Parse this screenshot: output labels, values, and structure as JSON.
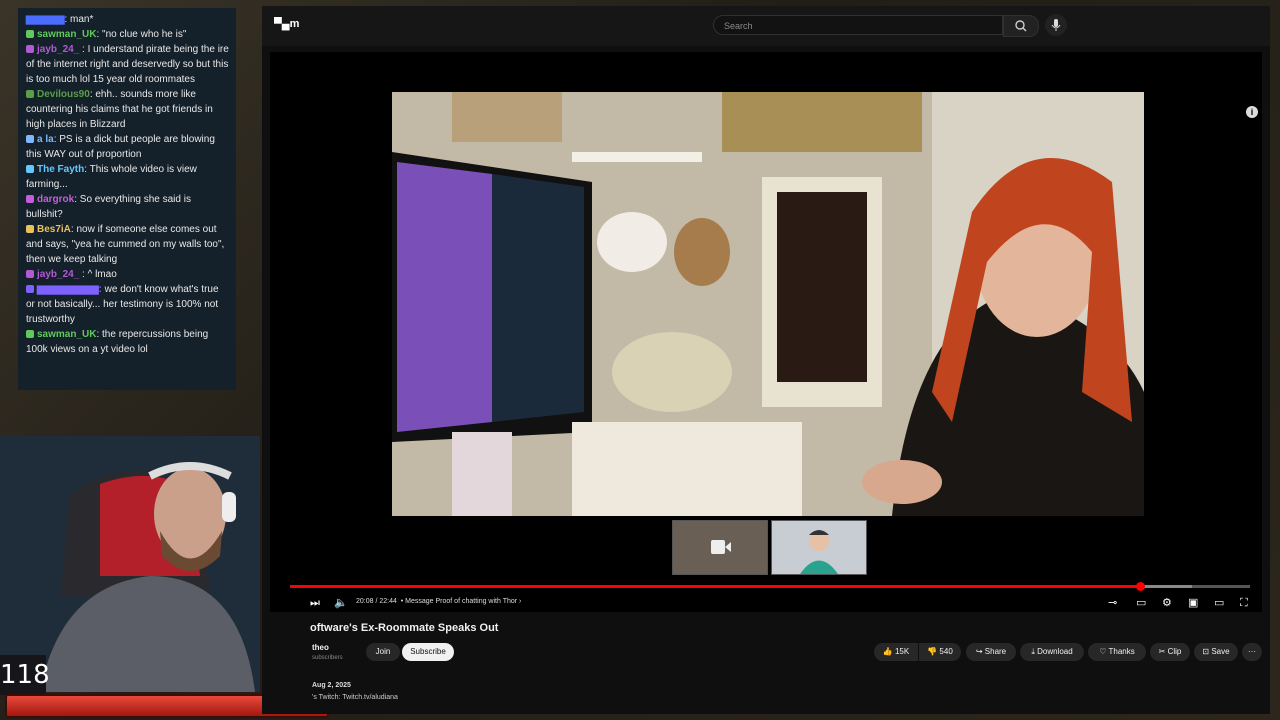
{
  "chat": {
    "messages": [
      {
        "user": "sawman_UK",
        "sep": ": ",
        "text": "\"no clue who he is\"",
        "color": "#61c95c"
      },
      {
        "user": "jayb_24_",
        "sep": " : ",
        "text": "I understand pirate being the ire of the internet right and deservedly so but this is too much lol 15 year old roommates",
        "color": "#b15ad1"
      },
      {
        "user": "Devilous90",
        "sep": ": ",
        "text": "ehh.. sounds more like countering his claims that he got friends in high places in Blizzard",
        "color": "#5a9e4a"
      },
      {
        "user": "a la",
        "sep": ": ",
        "text": "PS is a dick but people are blowing this WAY out of proportion",
        "color": "#7fb6ff"
      },
      {
        "user": "The Fayth",
        "sep": ": ",
        "text": "This whole video is view farming...",
        "color": "#64c8ff"
      },
      {
        "user": "dargrok",
        "sep": ": ",
        "text": "So everything she said is bullshit?",
        "color": "#c55ddb"
      },
      {
        "user": "Bes7iA",
        "sep": ": ",
        "text": "now if someone else comes out and says, \"yea he cummed on my walls too\", then we keep talking",
        "color": "#e8c15a"
      },
      {
        "user": "jayb_24_",
        "sep": " : ",
        "text": "^ lmao",
        "color": "#b15ad1"
      },
      {
        "user": "",
        "sep": "",
        "text": "we don't know what's true or not basically... her testimony is 100% not trustworthy",
        "color": "#7e62ff"
      },
      {
        "user": "sawman_UK",
        "sep": ": ",
        "text": "the repercussions being 100k views on a yt video lol",
        "color": "#61c95c"
      }
    ],
    "top_partial": "man*"
  },
  "overlay": {
    "counter": "118"
  },
  "youtube": {
    "search_placeholder": "Search",
    "player": {
      "time": "20:08 / 22:44",
      "chapter": "• Message Proof of chatting with Thor",
      "progress_fraction": 0.885,
      "buffer_fraction": 0.94
    },
    "video_title": "oftware's Ex-Roommate Speaks Out",
    "channel_name": "theo",
    "subscribers": "subscribers",
    "join_label": "Join",
    "subscribe_label": "Subscribe",
    "likes": "15K",
    "dislikes": "540",
    "share_label": "Share",
    "download_label": "Download",
    "thanks_label": "Thanks",
    "clip_label": "Clip",
    "save_label": "Save",
    "more_label": "···",
    "description_date": "Aug 2, 2025",
    "description_text": "'s Twitch: Twitch.tv/aludiana"
  },
  "colors": {
    "youtube_red": "#ff0000",
    "yt_bg": "#0f0f0f"
  }
}
